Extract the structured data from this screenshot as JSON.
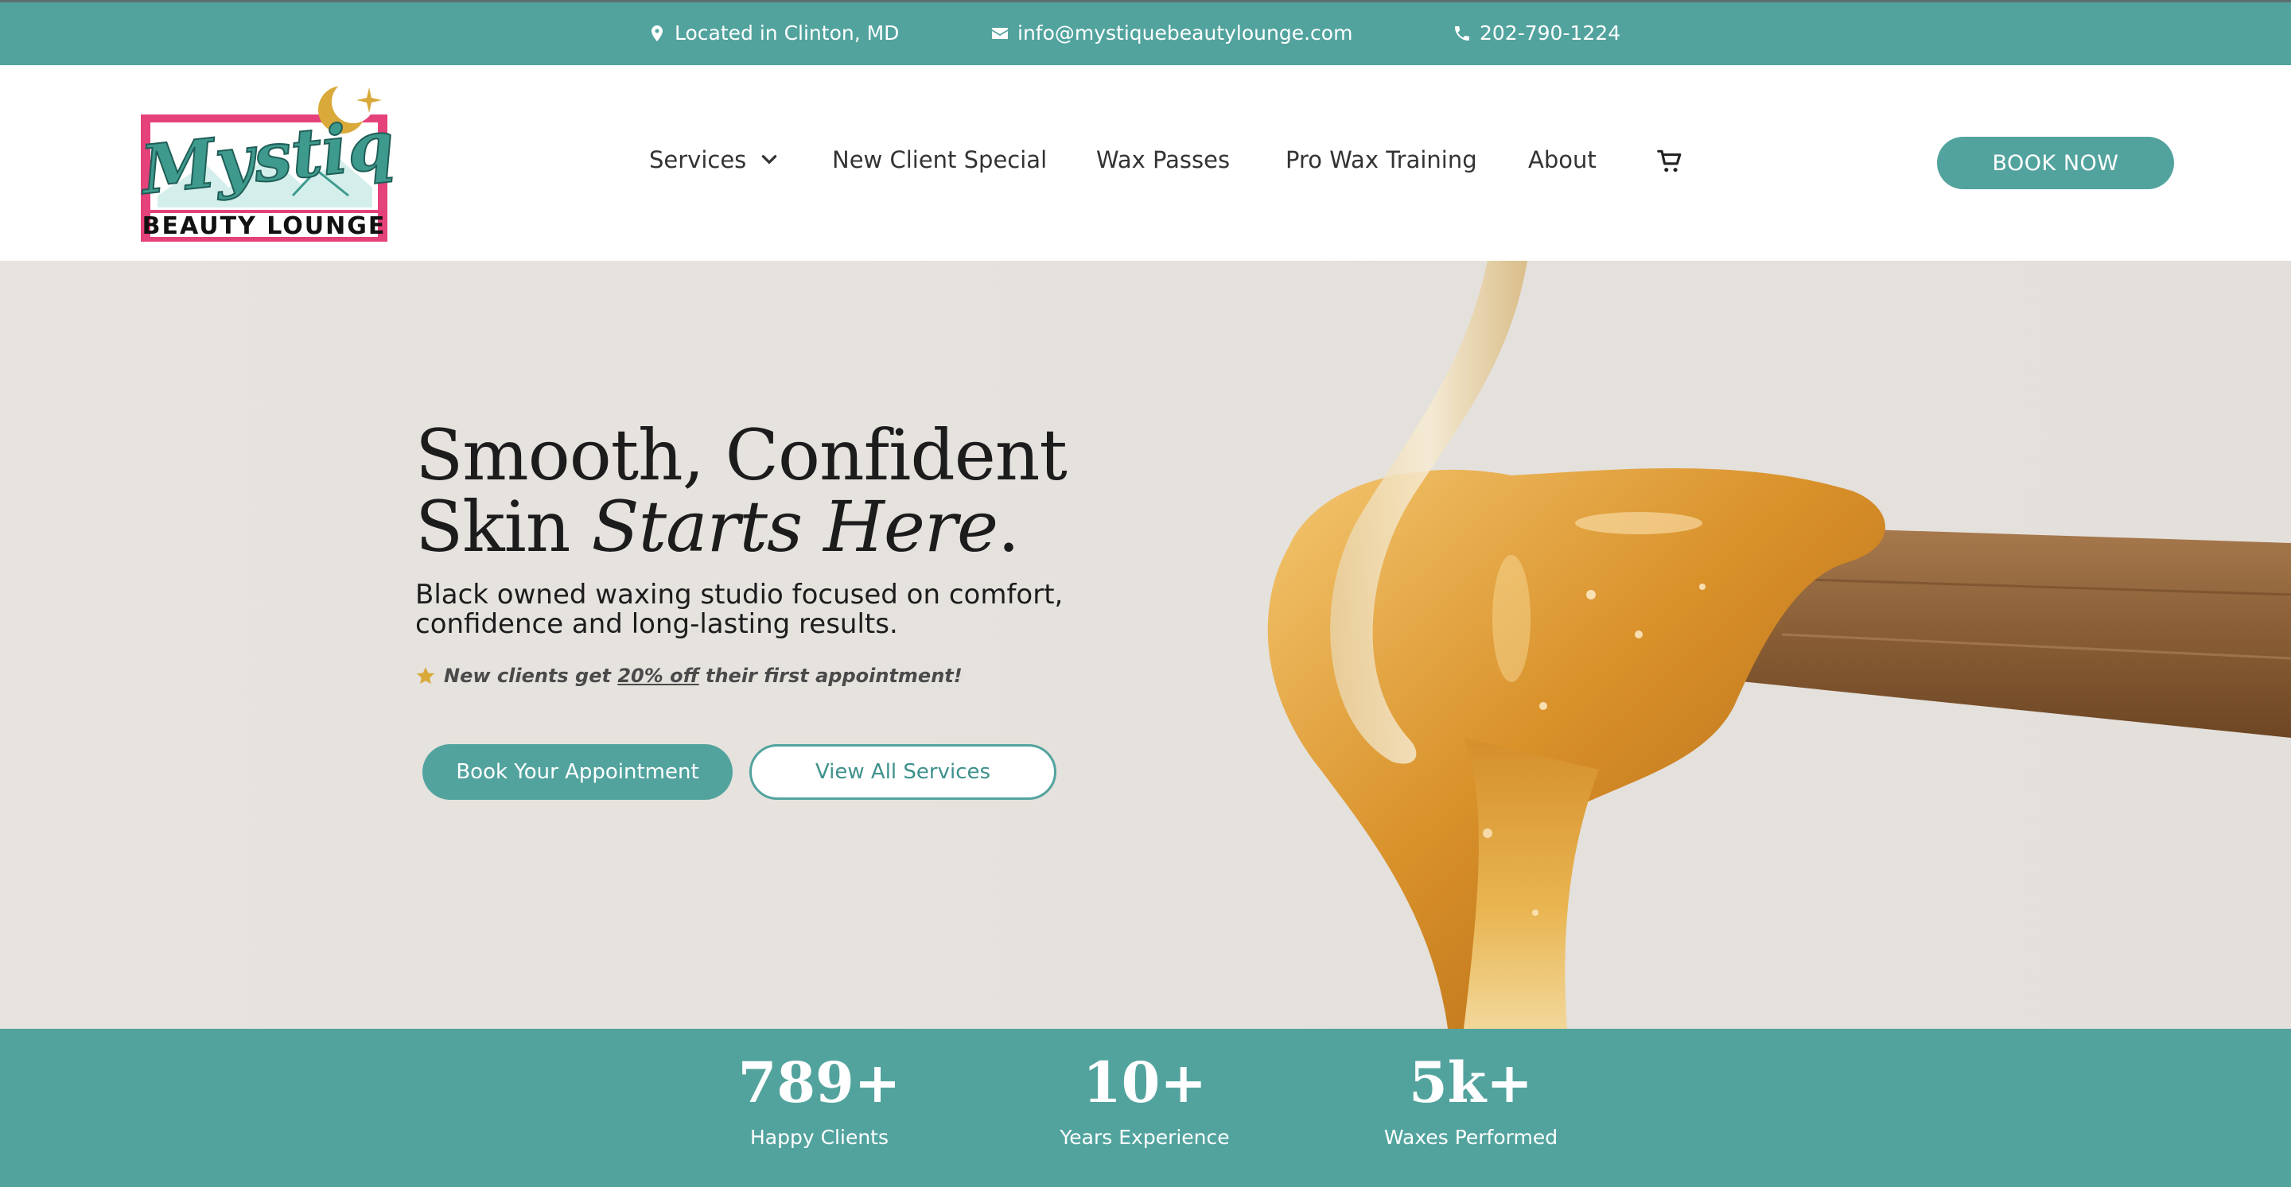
{
  "topbar": {
    "location": "Located in Clinton, MD",
    "email": "info@mystiquebeautylounge.com",
    "phone": "202-790-1224"
  },
  "logo": {
    "script_text": "Mystique",
    "sub_text": "BEAUTY LOUNGE"
  },
  "nav": {
    "items": [
      {
        "label": "Services",
        "icon": "chevron-down-icon"
      },
      {
        "label": "New Client Special"
      },
      {
        "label": "Wax Passes"
      },
      {
        "label": "Pro Wax Training"
      },
      {
        "label": "About"
      }
    ],
    "cart_icon": "cart-icon",
    "book_now": "BOOK NOW"
  },
  "hero": {
    "headline_line1": "Smooth, Confident",
    "headline_line2_plain": "Skin ",
    "headline_line2_italic": "Starts Here",
    "headline_line2_end": ".",
    "subtext": "Black owned waxing studio focused on comfort, confidence and long-lasting results.",
    "promo_prefix": "New clients get ",
    "promo_highlight": "20% off",
    "promo_suffix": " their first appointment!",
    "primary_button": "Book Your Appointment",
    "secondary_button": "View All Services"
  },
  "stats": [
    {
      "value": "789+",
      "label": "Happy Clients"
    },
    {
      "value": "10+",
      "label": "Years Experience"
    },
    {
      "value": "5k+",
      "label": "Waxes Performed"
    }
  ],
  "colors": {
    "brand_teal": "#52a39e",
    "logo_pink": "#e5417a",
    "logo_teal": "#3f9a8e",
    "gold": "#d9a93a"
  }
}
